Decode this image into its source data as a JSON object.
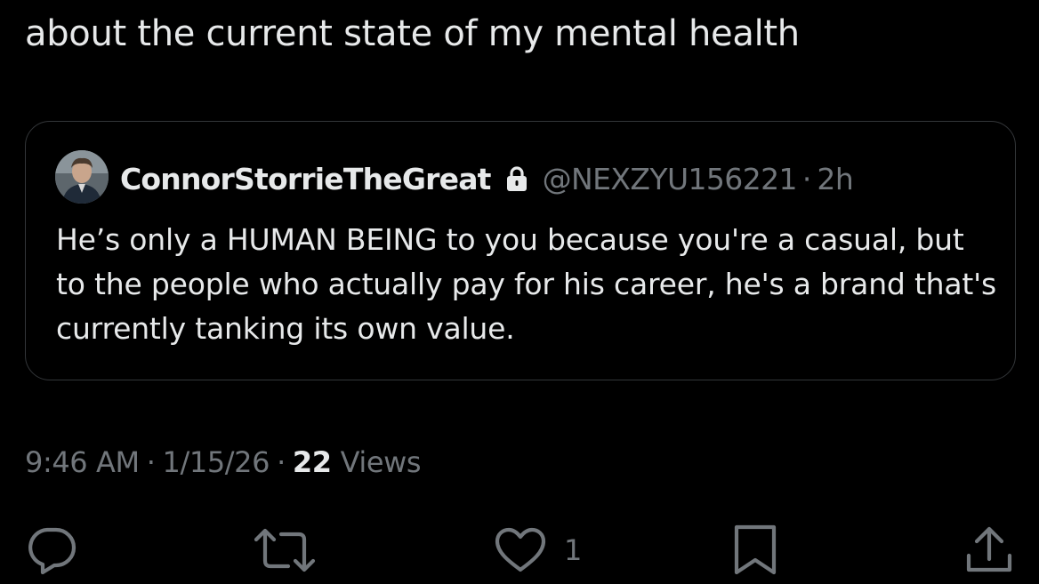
{
  "tweet": {
    "text": "about the current state of my mental health"
  },
  "quote": {
    "author_name": "ConnorStorrieTheGreat",
    "protected_icon": "lock-icon",
    "handle": "@NEXZYU156221",
    "separator": "·",
    "time_ago": "2h",
    "body": "He’s only a HUMAN BEING to you because you're a casual, but to the people who actually pay for his career, he's a brand that's currently tanking its own value."
  },
  "meta": {
    "time": "9:46 AM",
    "separator": "·",
    "date": "1/15/26",
    "views_count": "22",
    "views_label": "Views"
  },
  "actions": {
    "reply_icon": "reply-icon",
    "retweet_icon": "retweet-icon",
    "like_icon": "like-icon",
    "like_count": "1",
    "bookmark_icon": "bookmark-icon",
    "share_icon": "share-icon"
  },
  "colors": {
    "background": "#000000",
    "primary_text": "#e7e9ea",
    "secondary_text": "#71767b",
    "border": "#333639"
  }
}
